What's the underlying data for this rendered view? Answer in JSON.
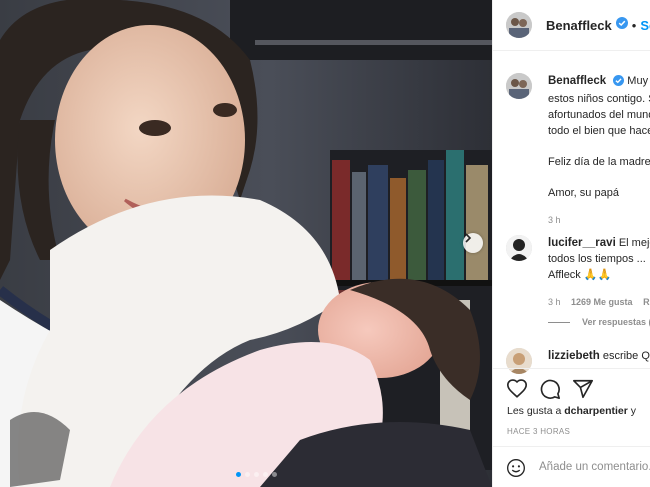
{
  "post": {
    "username": "Benaffleck",
    "follow_label": "Seguir",
    "separator": "•"
  },
  "caption": {
    "username": "Benaffleck",
    "lines": [
      "Muy feliz de tener",
      "estos niños contigo. Somos",
      "afortunados del mundo. Te deseo",
      "todo el bien que haces."
    ],
    "greeting": "Feliz día de la madre",
    "signoff": "Amor, su papá",
    "time": "3 h"
  },
  "comments": [
    {
      "username": "lucifer__ravi",
      "text_lines": [
        "El mejor",
        "todos los tiempos ...",
        "Affleck 🙏🙏"
      ],
      "time": "3 h",
      "likes": "1269 Me gusta",
      "reply": "R",
      "view_replies": "Ver respuestas (..."
    },
    {
      "username": "lizziebeth",
      "text": "escribe",
      "extra": "Q"
    }
  ],
  "actions": {
    "like": "heart-icon",
    "comment": "comment-icon",
    "share": "share-icon"
  },
  "likes_line": {
    "prefix": "Les gusta a",
    "user": "dcharpentier",
    "suffix": "y"
  },
  "time_ago": "HACE 3 HORAS",
  "add_comment": {
    "placeholder": "Añade un comentario..."
  },
  "carousel": {
    "count": 5,
    "active": 0
  },
  "colors": {
    "accent": "#0095f6",
    "verified": "#3897f0",
    "muted": "#8e8e8e"
  }
}
